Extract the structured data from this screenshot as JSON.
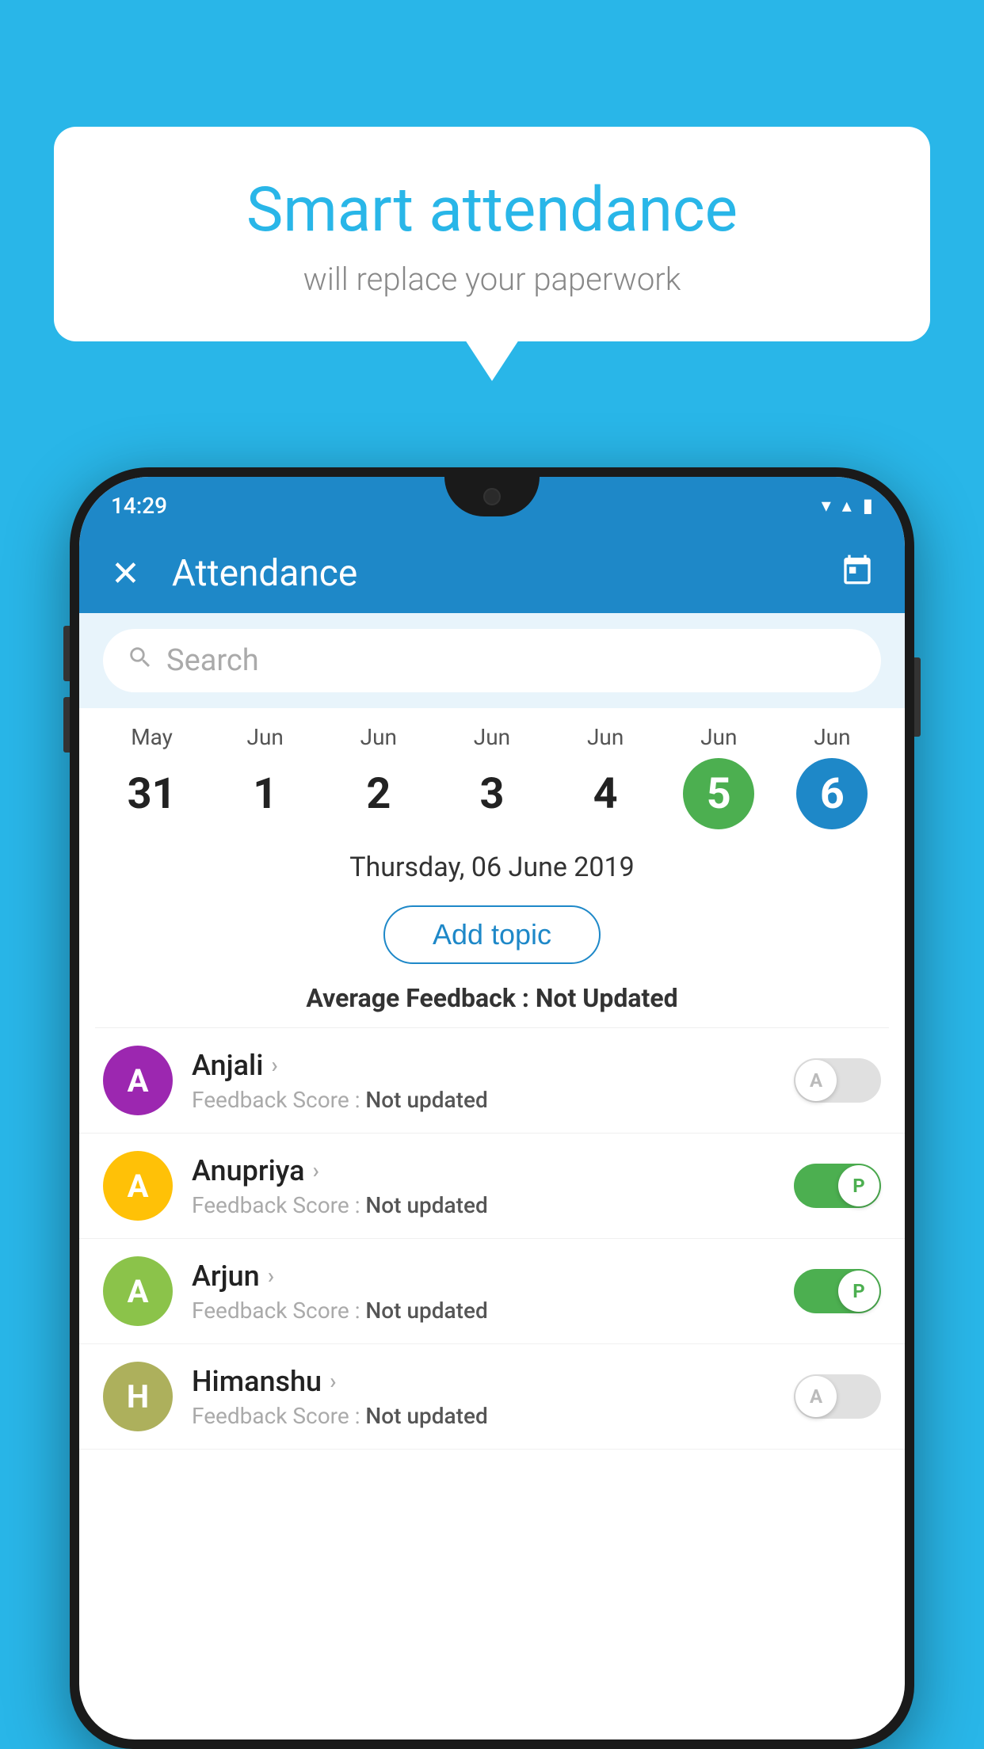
{
  "background_color": "#29b6e8",
  "speech_bubble": {
    "title": "Smart attendance",
    "subtitle": "will replace your paperwork"
  },
  "status_bar": {
    "time": "14:29",
    "wifi_icon": "▼",
    "signal_icon": "▲",
    "battery_icon": "▮"
  },
  "app_header": {
    "title": "Attendance",
    "close_label": "✕",
    "calendar_icon": "📅"
  },
  "search": {
    "placeholder": "Search"
  },
  "calendar": {
    "days": [
      {
        "month": "May",
        "date": "31",
        "state": "normal"
      },
      {
        "month": "Jun",
        "date": "1",
        "state": "normal"
      },
      {
        "month": "Jun",
        "date": "2",
        "state": "normal"
      },
      {
        "month": "Jun",
        "date": "3",
        "state": "normal"
      },
      {
        "month": "Jun",
        "date": "4",
        "state": "normal"
      },
      {
        "month": "Jun",
        "date": "5",
        "state": "selected-green"
      },
      {
        "month": "Jun",
        "date": "6",
        "state": "selected-blue"
      }
    ]
  },
  "selected_date": "Thursday, 06 June 2019",
  "add_topic_label": "Add topic",
  "average_feedback": {
    "label": "Average Feedback : ",
    "value": "Not Updated"
  },
  "students": [
    {
      "name": "Anjali",
      "avatar_letter": "A",
      "avatar_color": "purple",
      "feedback_label": "Feedback Score : ",
      "feedback_value": "Not updated",
      "toggle_state": "off",
      "toggle_label": "A"
    },
    {
      "name": "Anupriya",
      "avatar_letter": "A",
      "avatar_color": "yellow",
      "feedback_label": "Feedback Score : ",
      "feedback_value": "Not updated",
      "toggle_state": "on",
      "toggle_label": "P"
    },
    {
      "name": "Arjun",
      "avatar_letter": "A",
      "avatar_color": "green",
      "feedback_label": "Feedback Score : ",
      "feedback_value": "Not updated",
      "toggle_state": "on",
      "toggle_label": "P"
    },
    {
      "name": "Himanshu",
      "avatar_letter": "H",
      "avatar_color": "olive",
      "feedback_label": "Feedback Score : ",
      "feedback_value": "Not updated",
      "toggle_state": "off",
      "toggle_label": "A"
    }
  ]
}
